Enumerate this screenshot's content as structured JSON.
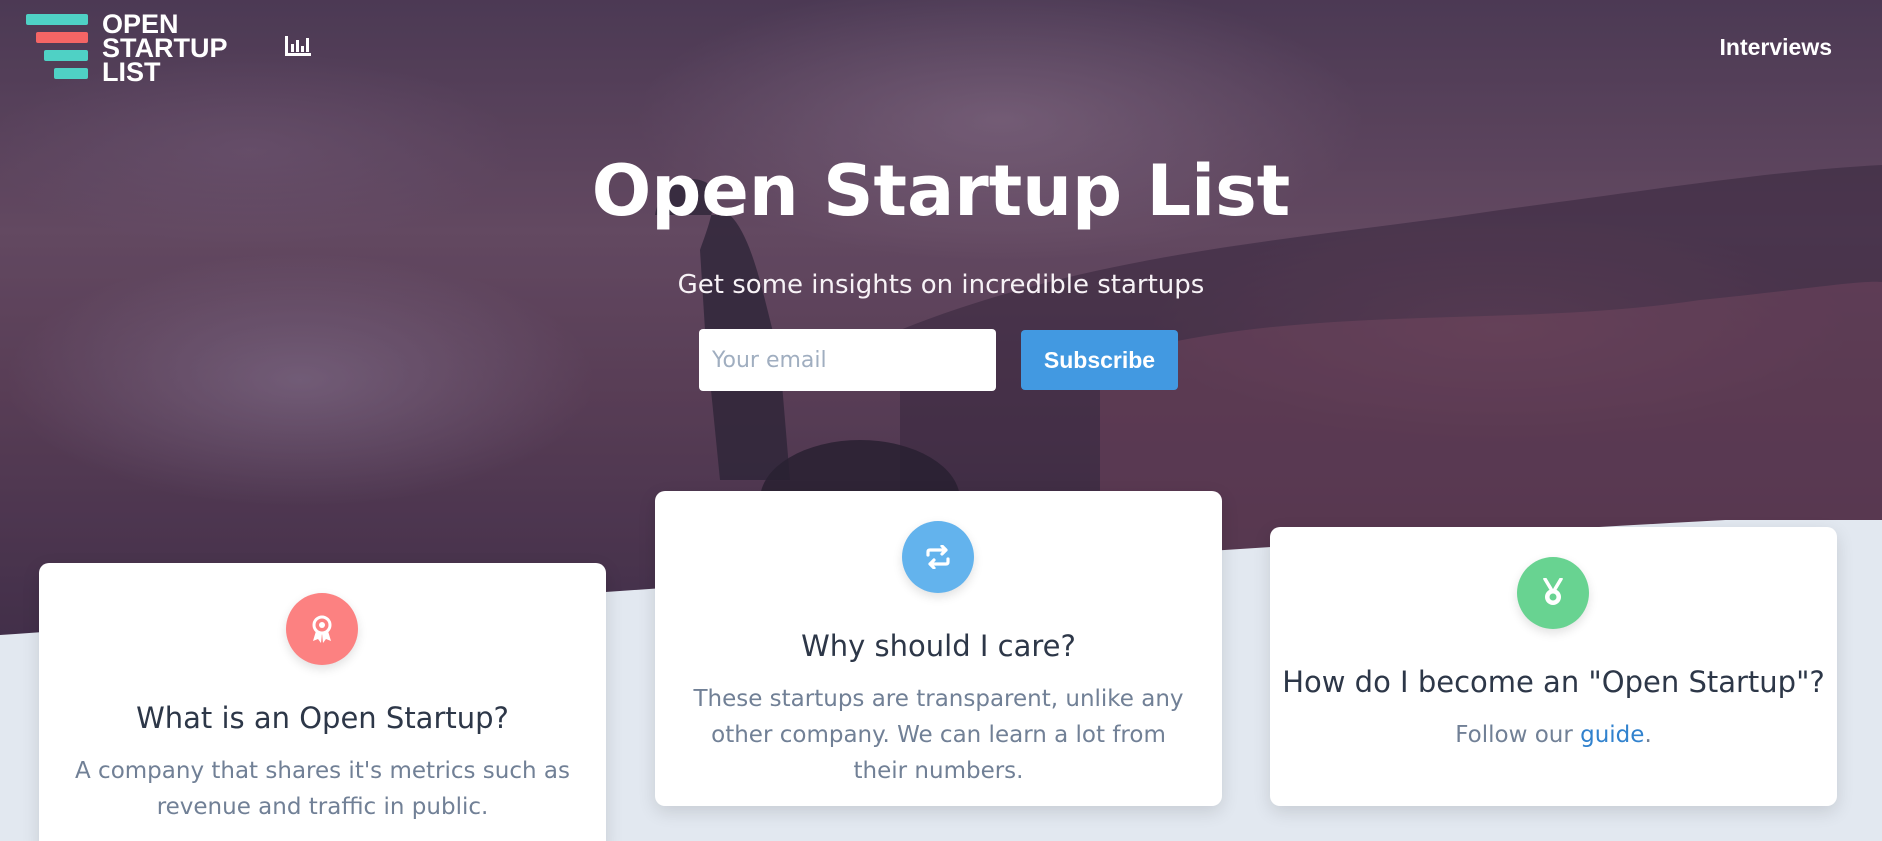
{
  "header": {
    "logo_lines": [
      "OPEN",
      "STARTUP",
      "LIST"
    ],
    "stats_icon": "bar-chart-icon",
    "nav_interviews": "Interviews"
  },
  "hero": {
    "title": "Open Startup List",
    "subtitle": "Get some insights on incredible startups",
    "email_placeholder": "Your email",
    "subscribe_label": "Subscribe"
  },
  "cards": [
    {
      "title": "What is an Open Startup?",
      "description": "A company that shares it's metrics such as revenue and traffic in public.",
      "icon": "award-icon",
      "icon_color": "#fc8181"
    },
    {
      "title": "Why should I care?",
      "description": "These startups are transparent, unlike any other company. We can learn a lot from their numbers.",
      "icon": "repeat-icon",
      "icon_color": "#63b3ed"
    },
    {
      "title": "How do I become an \"Open Startup\"?",
      "description_prefix": "Follow our ",
      "link_text": "guide",
      "description_suffix": ".",
      "icon": "medal-icon",
      "icon_color": "#68d391"
    }
  ],
  "colors": {
    "logo_teal": "#4fd1c5",
    "logo_red": "#f56565",
    "button_blue": "#4299e1",
    "link_blue": "#3182ce",
    "page_bg": "#e2e8f0"
  }
}
